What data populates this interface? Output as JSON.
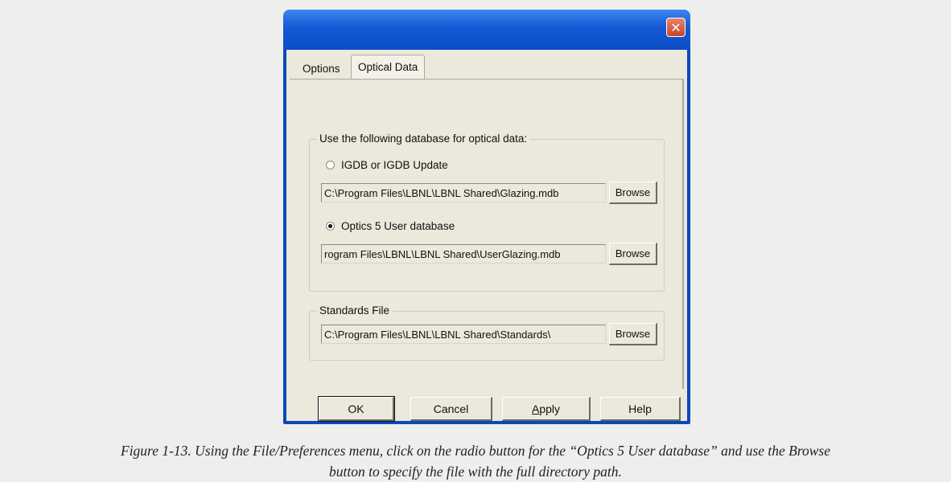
{
  "dialog": {
    "close_glyph": "✕",
    "tabs": [
      {
        "label": "Options",
        "selected": false
      },
      {
        "label": "Optical Data",
        "selected": true
      }
    ],
    "database_group": {
      "legend": "Use the following database for optical data:",
      "option_igdb": {
        "label": "IGDB or IGDB Update",
        "checked": false
      },
      "igdb_path": "C:\\Program Files\\LBNL\\LBNL Shared\\Glazing.mdb",
      "option_user": {
        "label": "Optics 5 User database",
        "checked": true
      },
      "user_path": "rogram Files\\LBNL\\LBNL Shared\\UserGlazing.mdb",
      "browse_label": "Browse"
    },
    "standards_group": {
      "legend": "Standards File",
      "path": "C:\\Program Files\\LBNL\\LBNL Shared\\Standards\\",
      "browse_label": "Browse"
    },
    "footer": {
      "ok": "OK",
      "cancel": "Cancel",
      "apply_first": "A",
      "apply_rest": "pply",
      "help": "Help"
    }
  },
  "caption": {
    "line1": "Figure 1-13. Using the File/Preferences menu, click on the radio button for the “Optics 5 User database” and use the Browse",
    "line2": "button to specify the file with the full directory path."
  },
  "colors": {
    "titlebar": "#1359d4",
    "close_button": "#c9432a",
    "dialog_face": "#ebe8dc"
  }
}
